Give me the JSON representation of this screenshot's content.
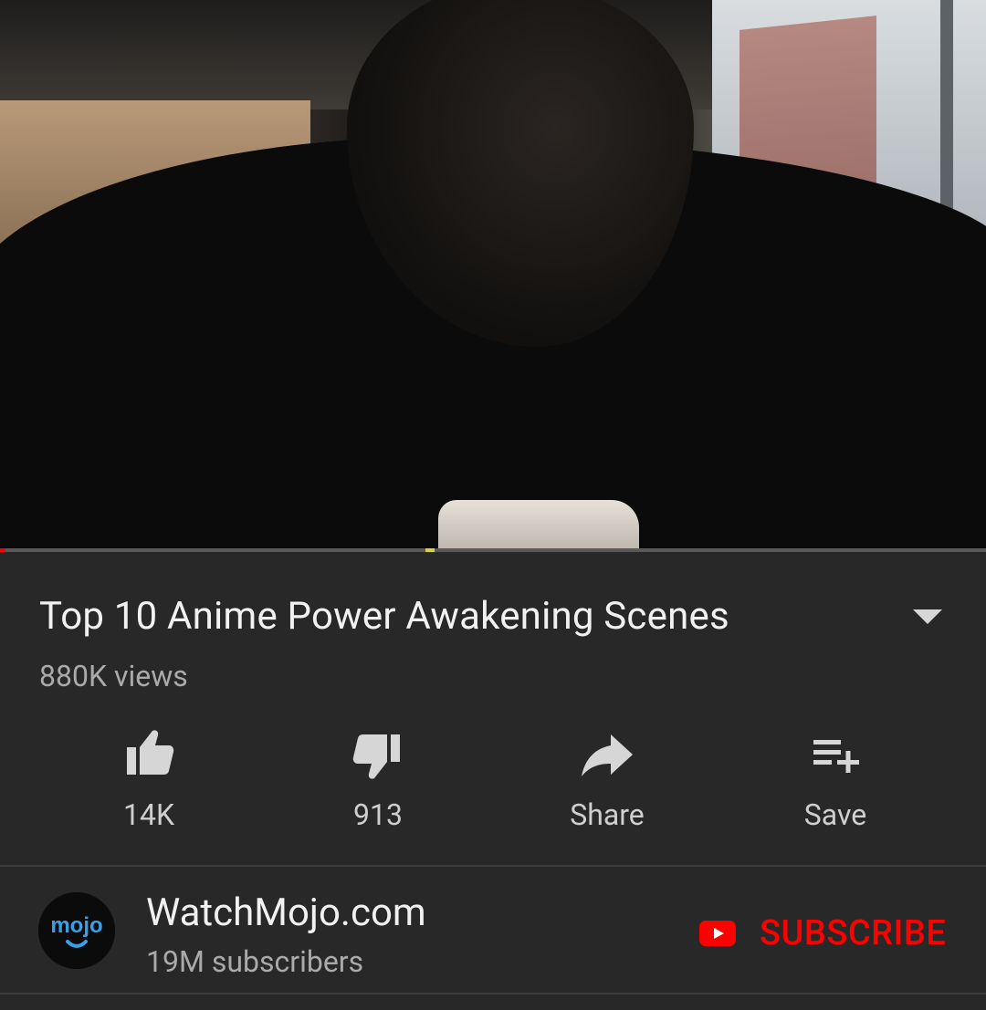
{
  "video": {
    "title": "Top 10 Anime Power Awakening Scenes",
    "views": "880K views"
  },
  "actions": {
    "like_count": "14K",
    "dislike_count": "913",
    "share_label": "Share",
    "save_label": "Save"
  },
  "channel": {
    "name": "WatchMojo.com",
    "subscribers": "19M subscribers",
    "avatar_text": "mojo"
  },
  "subscribe": {
    "label": "SUBSCRIBE"
  },
  "colors": {
    "background": "#282828",
    "primary_text": "#f1f1f1",
    "secondary_text": "#aaaaaa",
    "subscribe_red": "#ff0000",
    "mojo_blue": "#3aa0e8"
  }
}
